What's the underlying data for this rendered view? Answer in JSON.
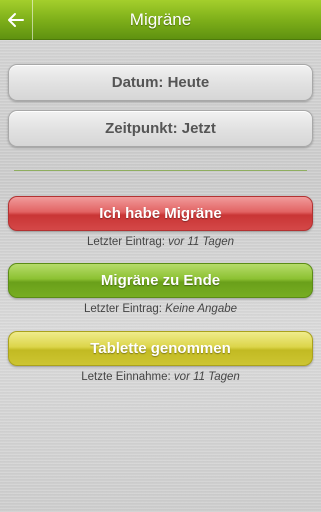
{
  "header": {
    "title": "Migräne",
    "back_icon": "arrow-left-icon"
  },
  "date_field": {
    "label": "Datum: Heute"
  },
  "time_field": {
    "label": "Zeitpunkt: Jetzt"
  },
  "actions": [
    {
      "label": "Ich habe Migräne",
      "info_label": "Letzter Eintrag:",
      "info_value": "vor 11 Tagen",
      "color": "#d64c4c"
    },
    {
      "label": "Migräne zu Ende",
      "info_label": "Letzter Eintrag:",
      "info_value": "Keine Angabe",
      "color": "#7db22a"
    },
    {
      "label": "Tablette genommen",
      "info_label": "Letzte Einnahme:",
      "info_value": "vor 11 Tagen",
      "color": "#cfc734"
    }
  ],
  "colors": {
    "appbar": "#7fb01a",
    "divider": "#8fae60"
  }
}
